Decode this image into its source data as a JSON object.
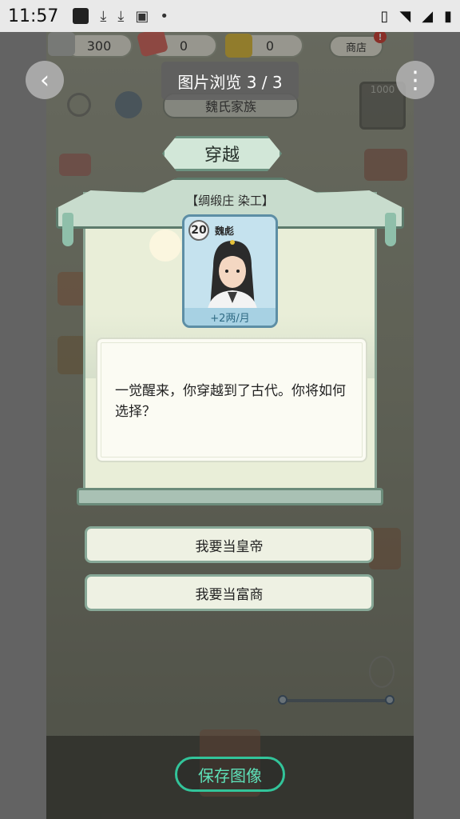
{
  "status_bar": {
    "time": "11:57"
  },
  "resources": {
    "silver": "300",
    "tickets": "0",
    "gold": "0",
    "shop_label": "商店",
    "shop_badge": "!"
  },
  "family": {
    "name": "魏氏家族",
    "side_counter": "1000"
  },
  "event": {
    "title": "穿越",
    "job_label": "【绸缎庄 染工】",
    "character": {
      "level": "20",
      "name": "魏彪",
      "income": "+2两/月"
    },
    "description": "一觉醒来，你穿越到了古代。你将如何选择？",
    "choices": [
      {
        "label": "我要当皇帝"
      },
      {
        "label": "我要当富商"
      }
    ]
  },
  "viewer": {
    "title": "图片浏览 3 / 3",
    "save_label": "保存图像",
    "back_icon": "‹",
    "more_icon": "⋮"
  },
  "colors": {
    "accent": "#32c49a",
    "panel": "#e9eed8",
    "frame": "#8ba796",
    "badge": "#d9362b"
  }
}
